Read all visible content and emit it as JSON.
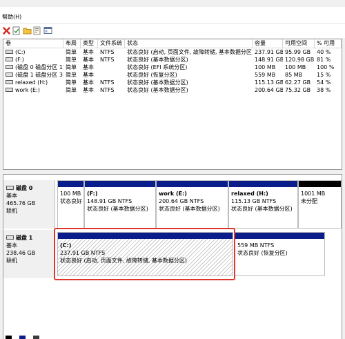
{
  "menu": {
    "item": "帮助(H)"
  },
  "volume_list": {
    "columns": [
      "卷",
      "布局",
      "类型",
      "文件系统",
      "状态",
      "容量",
      "可用空间",
      "% 可用"
    ],
    "rows": [
      [
        "(C:)",
        "简单",
        "基本",
        "NTFS",
        "状态良好 (启动, 页面文件, 故障转储, 基本数据分区)",
        "237.91 GB",
        "95.99 GB",
        "40 %"
      ],
      [
        "(F:)",
        "简单",
        "基本",
        "NTFS",
        "状态良好 (基本数据分区)",
        "148.91 GB",
        "120.98 GB",
        "81 %"
      ],
      [
        "(磁盘 0 磁盘分区 1)",
        "简单",
        "基本",
        "",
        "状态良好 (EFI 系统分区)",
        "100 MB",
        "100 MB",
        "100 %"
      ],
      [
        "(磁盘 1 磁盘分区 3)",
        "简单",
        "基本",
        "",
        "状态良好 (恢复分区)",
        "559 MB",
        "85 MB",
        "15 %"
      ],
      [
        "relaxed (H:)",
        "简单",
        "基本",
        "NTFS",
        "状态良好 (基本数据分区)",
        "115.13 GB",
        "62.27 GB",
        "54 %"
      ],
      [
        "work (E:)",
        "简单",
        "基本",
        "NTFS",
        "状态良好 (基本数据分区)",
        "200.64 GB",
        "75.32 GB",
        "38 %"
      ]
    ]
  },
  "disk0": {
    "title": "磁盘 0",
    "type": "基本",
    "size": "465.76 GB",
    "status": "联机",
    "partitions": [
      {
        "name": "",
        "size": "100 MB",
        "status": "状态良好"
      },
      {
        "name": "(F:)",
        "size": "148.91 GB NTFS",
        "status": "状态良好 (基本数据分区)"
      },
      {
        "name": "work (E:)",
        "size": "200.64 GB NTFS",
        "status": "状态良好 (基本数据分区)"
      },
      {
        "name": "relaxed (H:)",
        "size": "115.13 GB NTFS",
        "status": "状态良好 (基本数据分区)"
      },
      {
        "name": "",
        "size": "1001 MB",
        "status": "未分配"
      }
    ]
  },
  "disk1": {
    "title": "磁盘 1",
    "type": "基本",
    "size": "238.46 GB",
    "status": "联机",
    "partitions": [
      {
        "name": "(C:)",
        "size": "237.91 GB NTFS",
        "status": "状态良好 (启动, 页面文件, 故障转储, 基本数据分区)"
      },
      {
        "name": "",
        "size": "559 MB NTFS",
        "status": "状态良好 (恢复分区)"
      }
    ]
  },
  "colors": {
    "partition_header": "#0b1d8a",
    "unallocated_header": "#000000",
    "highlight_box": "#e0352b"
  }
}
